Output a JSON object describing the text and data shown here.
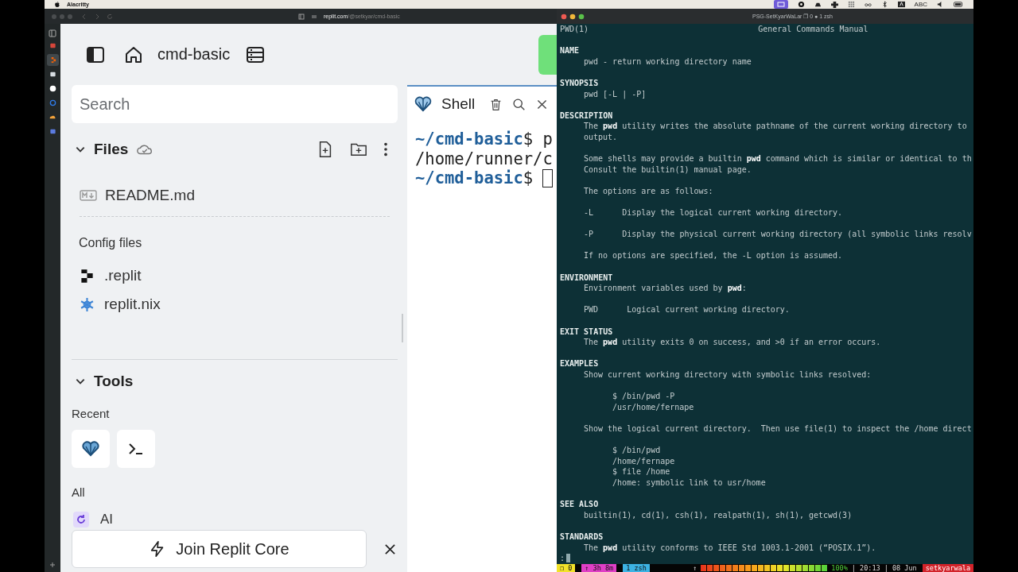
{
  "menu_bar": {
    "app_name": "Alacritty",
    "input_label": "ABC"
  },
  "browser": {
    "url_host": "replit.com",
    "url_path": "/@setkyar/cmd-basic",
    "sidebar_tabs": [
      {
        "kind": "mail",
        "selected": false
      },
      {
        "kind": "replit",
        "selected": true
      },
      {
        "kind": "book",
        "selected": false
      },
      {
        "kind": "github",
        "selected": false
      },
      {
        "kind": "sync",
        "selected": false
      },
      {
        "kind": "cloud",
        "selected": false
      },
      {
        "kind": "app",
        "selected": false
      }
    ]
  },
  "replit": {
    "project": "cmd-basic",
    "search": {
      "placeholder": "Search"
    },
    "files": {
      "title": "Files",
      "expanded": true,
      "items": [
        {
          "name": "README.md",
          "kind": "markdown"
        }
      ],
      "config_title": "Config files",
      "config_items": [
        {
          "name": ".replit",
          "kind": "replit"
        },
        {
          "name": "replit.nix",
          "kind": "nix"
        }
      ]
    },
    "tools": {
      "title": "Tools",
      "expanded": true,
      "recent_label": "Recent",
      "recent": [
        {
          "kind": "shell"
        },
        {
          "kind": "console"
        }
      ],
      "all_label": "All",
      "all": [
        {
          "name": "AI",
          "kind": "ai"
        }
      ]
    },
    "upgrade_button": "Join Replit Core",
    "shell": {
      "tab": "Shell",
      "cursor": true,
      "lines": [
        [
          {
            "text": "~/cmd-basic",
            "kind": "path"
          },
          {
            "text": "$ p",
            "kind": "plain"
          }
        ],
        [
          {
            "text": "/home/runner/c",
            "kind": "plain"
          }
        ],
        [
          {
            "text": "~/cmd-basic",
            "kind": "path"
          },
          {
            "text": "$ ",
            "kind": "plain"
          }
        ]
      ]
    }
  },
  "terminal": {
    "title": "PSG-SetKyarWaLar ❐ 0 ● 1 zsh",
    "man": {
      "header_left": "PWD(1)",
      "header_center": "General Commands Manual",
      "sections": [
        {
          "heading": "NAME",
          "paragraphs": [
            {
              "kind": "text",
              "lines": [
                "pwd - return working directory name"
              ]
            }
          ]
        },
        {
          "heading": "SYNOPSIS",
          "paragraphs": [
            {
              "kind": "text",
              "lines": [
                "pwd [-L | -P]"
              ]
            }
          ]
        },
        {
          "heading": "DESCRIPTION",
          "paragraphs": [
            {
              "kind": "text",
              "lines": [
                "The **pwd** utility writes the absolute pathname of the current working directory to",
                "output."
              ]
            },
            {
              "kind": "text",
              "lines": [
                "Some shells may provide a builtin **pwd** command which is similar or identical to th",
                "Consult the builtin(1) manual page."
              ]
            },
            {
              "kind": "text",
              "lines": [
                "The options are as follows:"
              ]
            },
            {
              "kind": "text",
              "lines": [
                "-L      Display the logical current working directory."
              ]
            },
            {
              "kind": "text",
              "lines": [
                "-P      Display the physical current working directory (all symbolic links resolv"
              ]
            },
            {
              "kind": "text",
              "lines": [
                "If no options are specified, the -L option is assumed."
              ]
            }
          ]
        },
        {
          "heading": "ENVIRONMENT",
          "paragraphs": [
            {
              "kind": "text",
              "lines": [
                "Environment variables used by **pwd**:"
              ]
            },
            {
              "kind": "text",
              "lines": [
                "PWD      Logical current working directory."
              ]
            }
          ]
        },
        {
          "heading": "EXIT STATUS",
          "paragraphs": [
            {
              "kind": "text",
              "lines": [
                "The **pwd** utility exits 0 on success, and >0 if an error occurs."
              ]
            }
          ]
        },
        {
          "heading": "EXAMPLES",
          "paragraphs": [
            {
              "kind": "text",
              "lines": [
                "Show current working directory with symbolic links resolved:"
              ]
            },
            {
              "kind": "code",
              "lines": [
                "$ /bin/pwd -P",
                "/usr/home/fernape"
              ]
            },
            {
              "kind": "text",
              "lines": [
                "Show the logical current directory.  Then use file(1) to inspect the /home direct"
              ]
            },
            {
              "kind": "code",
              "lines": [
                "$ /bin/pwd",
                "/home/fernape",
                "$ file /home",
                "/home: symbolic link to usr/home"
              ]
            }
          ]
        },
        {
          "heading": "SEE ALSO",
          "paragraphs": [
            {
              "kind": "text",
              "lines": [
                "builtin(1), cd(1), csh(1), realpath(1), sh(1), getcwd(3)"
              ]
            }
          ]
        },
        {
          "heading": "STANDARDS",
          "paragraphs": [
            {
              "kind": "text",
              "lines": [
                "The **pwd** utility conforms to IEEE Std 1003.1-2001 (“POSIX.1”)."
              ]
            }
          ]
        }
      ],
      "prompt": ":"
    },
    "status_bar": {
      "segments": [
        {
          "text": "❐ 0",
          "color": "#f2e22a"
        },
        {
          "text": "↑ 3h 8m",
          "color": "#e03fc6"
        },
        {
          "text": "1 zsh",
          "color": "#3cb3e4"
        }
      ],
      "uptime_arrow": "↑",
      "battery": {
        "level": 1,
        "reading": "100%"
      },
      "clock": "| 20:13 | 08 Jun",
      "host": "setkyarwala"
    }
  }
}
